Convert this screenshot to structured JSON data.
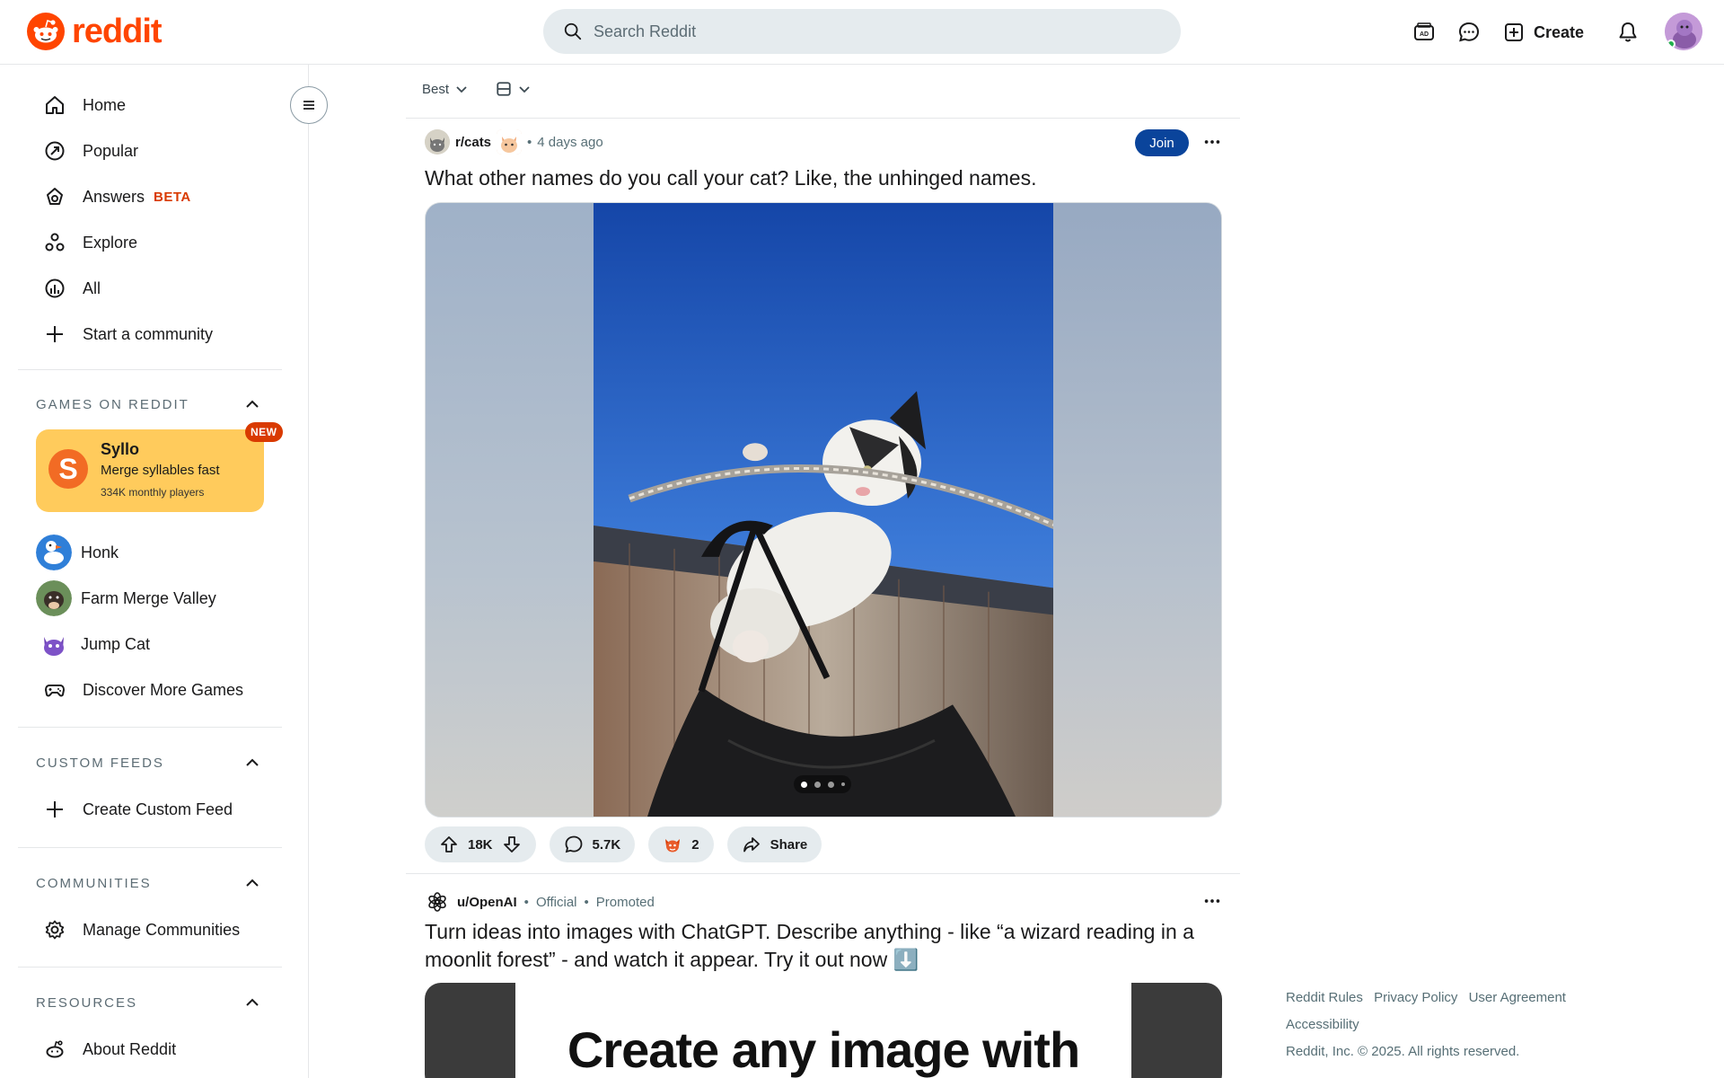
{
  "header": {
    "logo_text": "reddit",
    "search_placeholder": "Search Reddit",
    "create_label": "Create",
    "icons": [
      "advertise-icon",
      "chat-icon",
      "create-icon",
      "notification-icon",
      "avatar"
    ]
  },
  "sidebar": {
    "nav": [
      {
        "label": "Home",
        "icon": "home-icon"
      },
      {
        "label": "Popular",
        "icon": "popular-icon"
      },
      {
        "label": "Answers",
        "icon": "answers-icon",
        "badge": "BETA"
      },
      {
        "label": "Explore",
        "icon": "explore-icon"
      },
      {
        "label": "All",
        "icon": "all-icon"
      },
      {
        "label": "Start a community",
        "icon": "plus-icon"
      }
    ],
    "games": {
      "heading": "GAMES ON REDDIT",
      "featured": {
        "title": "Syllo",
        "subtitle": "Merge syllables fast",
        "players": "334K monthly players",
        "badge": "NEW",
        "logo_letter": "S"
      },
      "items": [
        {
          "label": "Honk"
        },
        {
          "label": "Farm Merge Valley"
        },
        {
          "label": "Jump Cat"
        },
        {
          "label": "Discover More Games"
        }
      ]
    },
    "custom_feeds": {
      "heading": "CUSTOM FEEDS",
      "items": [
        {
          "label": "Create Custom Feed"
        }
      ]
    },
    "communities": {
      "heading": "COMMUNITIES",
      "items": [
        {
          "label": "Manage Communities"
        }
      ]
    },
    "resources": {
      "heading": "RESOURCES",
      "items": [
        {
          "label": "About Reddit"
        }
      ]
    }
  },
  "feed": {
    "sort_label": "Best",
    "posts": [
      {
        "subreddit": "r/cats",
        "time": "4 days ago",
        "join_label": "Join",
        "title": "What other names do you call your cat? Like, the unhinged names.",
        "upvotes": "18K",
        "comments": "5.7K",
        "awards": "2",
        "share_label": "Share",
        "gallery_dots": 4,
        "gallery_index": 1
      },
      {
        "user": "u/OpenAI",
        "official": "Official",
        "promoted": "Promoted",
        "title": "Turn ideas into images with ChatGPT. Describe anything - like “a wizard reading in a moonlit forest” - and watch it appear. Try it out now ⬇️",
        "image_text": "Create any image with"
      }
    ]
  },
  "footer": {
    "links": [
      "Reddit Rules",
      "Privacy Policy",
      "User Agreement",
      "Accessibility"
    ],
    "copyright": "Reddit, Inc. © 2025. All rights reserved."
  },
  "colors": {
    "brand": "#ff4500",
    "join": "#0a449b",
    "beta": "#d93a00",
    "game_card": "#ffcb5c"
  }
}
